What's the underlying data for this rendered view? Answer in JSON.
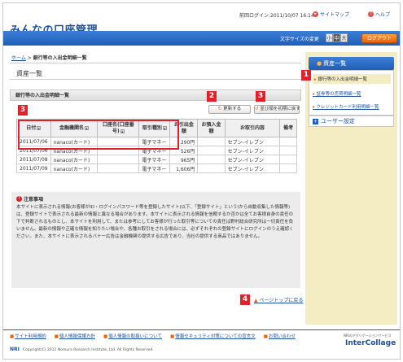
{
  "header": {
    "app_title": "みんなの口座管理",
    "last_login": "前回ログイン:2011/10/07 16:14",
    "sitemap": "サイトマップ",
    "help": "ヘルプ",
    "font_size_label": "文字サイズの変更",
    "font_sizes": [
      "小",
      "中",
      "大"
    ],
    "logout": "ログアウト"
  },
  "breadcrumb": {
    "home": "ホーム",
    "separator": " > ",
    "current": "銀行等の入出金明細一覧"
  },
  "main": {
    "section_title": "資産一覧",
    "sub_title": "銀行等の入出金明細一覧",
    "refresh_button": "更新する",
    "reset_button": "並び順を初期に戻す",
    "table": {
      "headers": [
        "日付",
        "金融機関名",
        "口座名(口座番号)",
        "取引種別",
        "お引出金額",
        "お預入金額",
        "お取引内容",
        "備考"
      ],
      "rows": [
        [
          "2011/07/06",
          "nanaco(カード)",
          "",
          "電子マネー",
          "290円",
          "",
          "セブン-イレブン",
          ""
        ],
        [
          "2011/07/06",
          "nanaco(カード)",
          "",
          "電子マネー",
          "526円",
          "",
          "セブン-イレブン",
          ""
        ],
        [
          "2011/07/08",
          "nanaco(カード)",
          "",
          "電子マネー",
          "965円",
          "",
          "セブン-イレブン",
          ""
        ],
        [
          "2011/07/09",
          "nanaco(カード)",
          "",
          "電子マネー",
          "1,606円",
          "",
          "セブン-イレブン",
          ""
        ]
      ]
    },
    "notice": {
      "title": "注意事項",
      "body": "本サイトに表示される情報(お客様がID・ログインパスワード等を登録したサイト(以下、「登録サイト」という)から自動収集した情報等)は、登録サイトで表示される最新の情報と異なる場合があります。本サイトに表示される情報を信頼するか否かは全てお客様自身の責任の下で判断されるものとし、本サイトを利用して、または参考にしてお客様が行った取引等についての責任は野村総合研究所は一切責任を負いません。最新の情報や正確な情報を知りたい場合や、各種お取引をされる場合には、必ずそれぞれの登録サイトにログインのうえ確認ください。また、本サイトに表示されるバナー広告は金融機関の提供する広告であり、当社の提供する商品ではありません。"
    },
    "page_top": "ページトップに戻る"
  },
  "sidebar": {
    "head": "資産一覧",
    "items": [
      "銀行等の入出金明細一覧",
      "証券等の売買明細一覧",
      "クレジットカード利用明細一覧"
    ],
    "user_settings": "ユーザー設定"
  },
  "callouts": [
    "1",
    "2",
    "3",
    "3",
    "4"
  ],
  "footer": {
    "links": [
      "サイト利用規約",
      "個人情報保護方針",
      "個人情報の取扱いについて",
      "情報セキュリティ対策についての宣言文",
      "お問い合わせ"
    ],
    "copyright_brand": "NRI",
    "copyright": "Copyright(C) 2011 Nomura Research Institute, Ltd. All Rights Reserved.",
    "logo_small": "NRIのアグリゲーションサービス",
    "logo": "InterCollage"
  },
  "colors": {
    "brand_blue": "#1e5eb8",
    "accent_orange": "#e8650a",
    "callout_red": "#e0202a",
    "sidebar_bg": "#f4edc4"
  }
}
